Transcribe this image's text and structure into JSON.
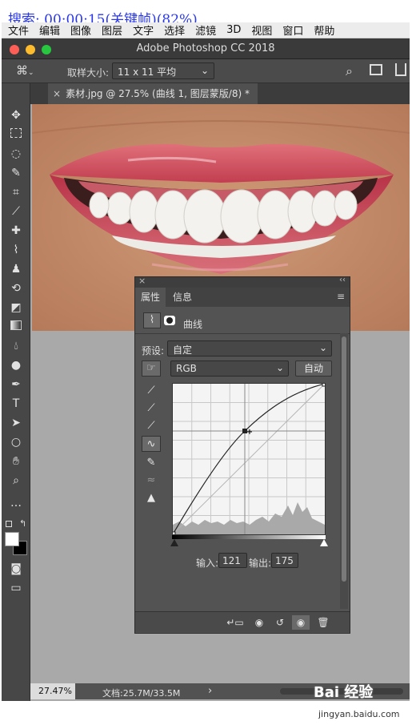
{
  "overlay_caption": "搜索: 00:00:15(关键帧)(82%)",
  "menu": [
    "文件",
    "编辑",
    "图像",
    "图层",
    "文字",
    "选择",
    "滤镜",
    "3D",
    "视图",
    "窗口",
    "帮助"
  ],
  "app_title": "Adobe Photoshop CC 2018",
  "options": {
    "sample_label": "取样大小:",
    "sample_value": "11 x 11 平均"
  },
  "document_tab": "素材.jpg @ 27.5% (曲线 1, 图层蒙版/8) *",
  "panel": {
    "tab_properties": "属性",
    "tab_info": "信息",
    "adjustment_title": "曲线",
    "preset_label": "预设:",
    "preset_value": "自定",
    "channel_value": "RGB",
    "auto_button": "自动",
    "input_label": "输入:",
    "input_value": "121",
    "output_label": "输出:",
    "output_value": "175"
  },
  "status": {
    "zoom": "27.47%",
    "doc": "文档:25.7M/33.5M",
    "arrow": "›"
  },
  "colors": {
    "lips": "#d1495a",
    "skin": "#c68f6c",
    "teeth": "#f2f2ee",
    "panel": "#535353",
    "canvas": "#a9a9a9"
  },
  "watermark": {
    "brand": "Bai 经验",
    "url": "jingyan.baidu.com"
  }
}
